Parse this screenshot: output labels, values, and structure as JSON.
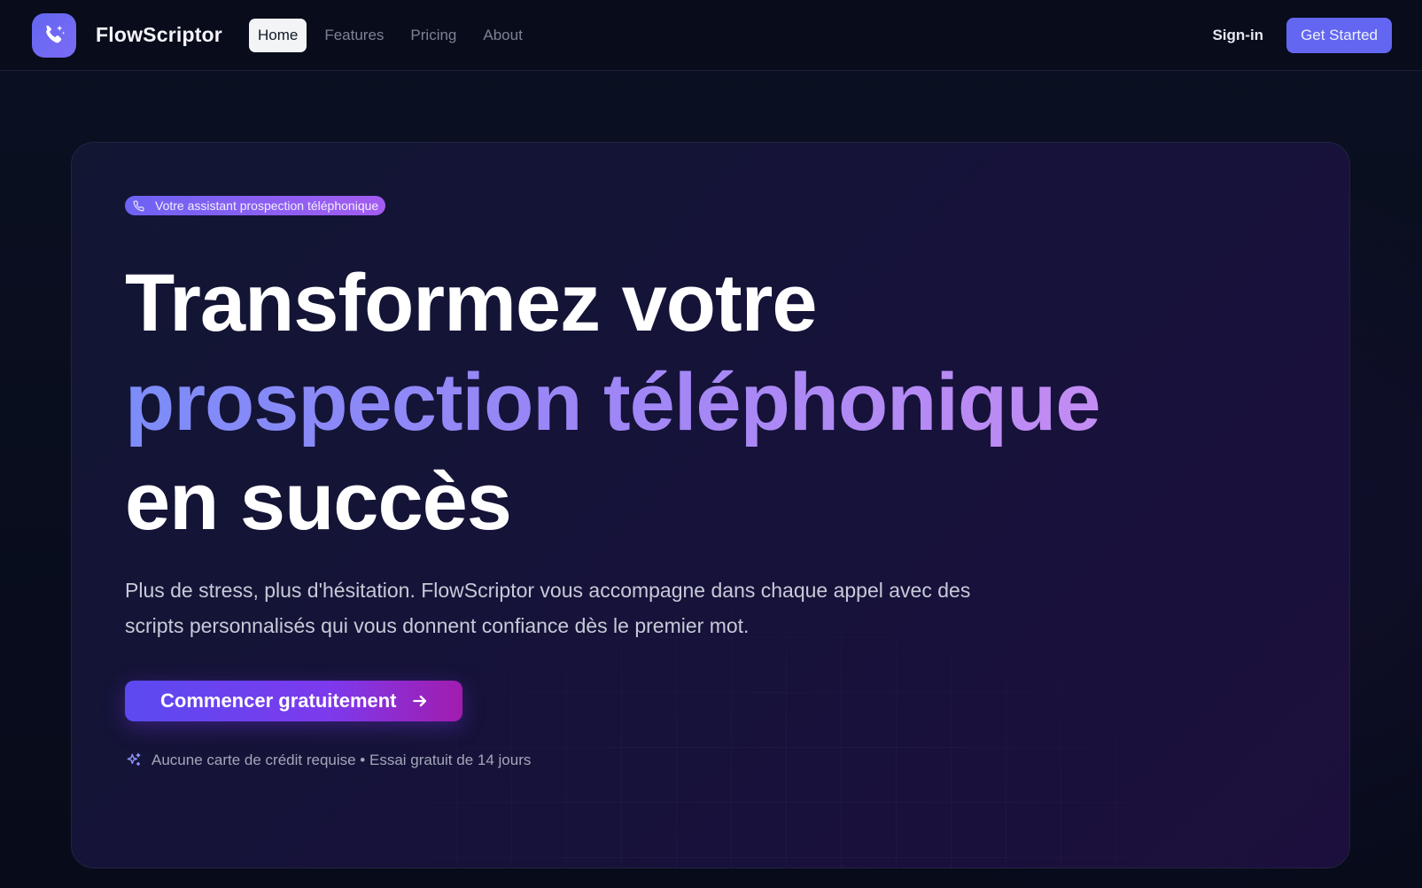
{
  "nav": {
    "brand": "FlowScriptor",
    "links": [
      {
        "label": "Home",
        "active": true
      },
      {
        "label": "Features",
        "active": false
      },
      {
        "label": "Pricing",
        "active": false
      },
      {
        "label": "About",
        "active": false
      }
    ],
    "signin_label": "Sign-in",
    "get_started_label": "Get Started"
  },
  "hero": {
    "badge_icon": "phone-icon",
    "badge_text": "Votre assistant prospection téléphonique",
    "headline_line1": "Transformez votre",
    "headline_line2": "prospection téléphonique",
    "headline_line3": "en succès",
    "description": "Plus de stress, plus d'hésitation. FlowScriptor vous accompagne dans chaque appel avec des scripts personnalisés qui vous donnent confiance dès le premier mot.",
    "cta_label": "Commencer gratuitement",
    "cta_icon": "arrow-right-icon",
    "note_icon": "sparkles-icon",
    "note_text": "Aucune carte de crédit requise • Essai gratuit de 14 jours"
  },
  "colors": {
    "accent": "#6366f1",
    "background": "#070b1a",
    "gradient_start": "#7c8cf8",
    "gradient_end": "#c38cf3"
  }
}
